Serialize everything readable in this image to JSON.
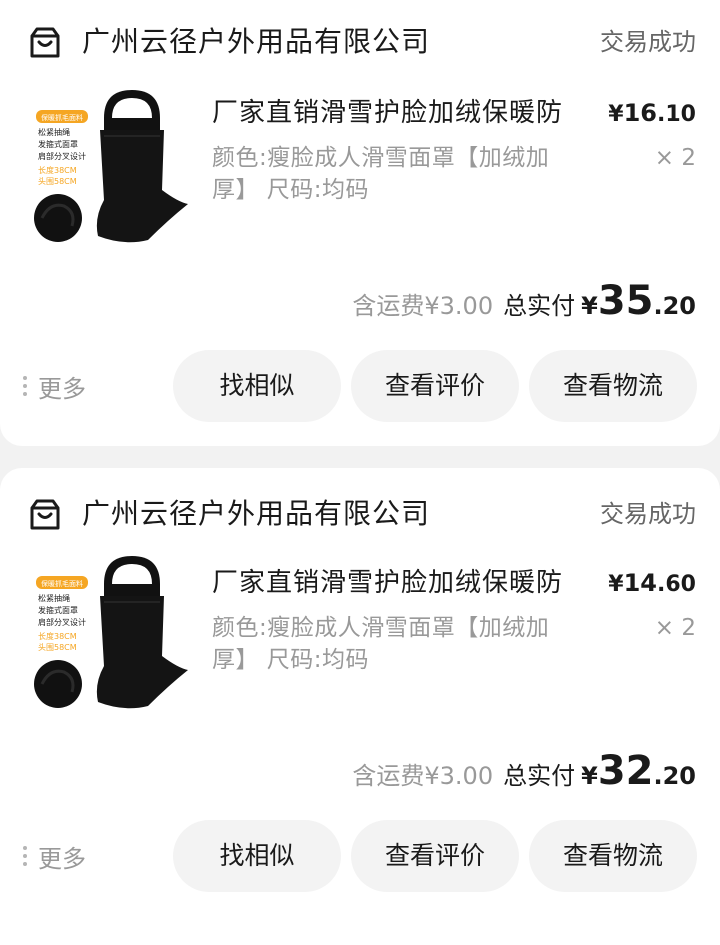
{
  "orders": [
    {
      "shop_name": "广州云径户外用品有限公司",
      "status": "交易成功",
      "product": {
        "title": "厂家直销滑雪护脸加绒保暖防",
        "spec": "颜色:瘦脸成人滑雪面罩【加绒加厚】 尺码:均码",
        "price_yen": "¥",
        "price_int": "16",
        "price_dec": ".10",
        "qty": "× 2",
        "image_text": {
          "badge": "保暖抓毛面料",
          "line1": "松紧抽绳",
          "line2": "发箍式面罩",
          "line3": "肩部分叉设计",
          "line4": "长度38CM",
          "line5": "头围58CM"
        }
      },
      "shipping": "含运费¥3.00",
      "total_label": "总实付",
      "total_yen": "¥",
      "total_int": "35",
      "total_dec": ".20",
      "more_label": "更多",
      "buttons": [
        "找相似",
        "查看评价",
        "查看物流"
      ]
    },
    {
      "shop_name": "广州云径户外用品有限公司",
      "status": "交易成功",
      "product": {
        "title": "厂家直销滑雪护脸加绒保暖防",
        "spec": "颜色:瘦脸成人滑雪面罩【加绒加厚】 尺码:均码",
        "price_yen": "¥",
        "price_int": "14",
        "price_dec": ".60",
        "qty": "× 2",
        "image_text": {
          "badge": "保暖抓毛面料",
          "line1": "松紧抽绳",
          "line2": "发箍式面罩",
          "line3": "肩部分叉设计",
          "line4": "长度38CM",
          "line5": "头围58CM"
        }
      },
      "shipping": "含运费¥3.00",
      "total_label": "总实付",
      "total_yen": "¥",
      "total_int": "32",
      "total_dec": ".20",
      "more_label": "更多",
      "buttons": [
        "找相似",
        "查看评价",
        "查看物流"
      ]
    }
  ],
  "colors": {
    "background": "#f2f2f2",
    "card": "#ffffff",
    "button_bg": "#f3f3f3",
    "secondary_text": "#999999",
    "primary_text": "#1a1a1a",
    "image_accent": "#f5a623"
  },
  "icons": {
    "shop": "shop-bag-icon",
    "more": "vertical-dots-icon"
  }
}
